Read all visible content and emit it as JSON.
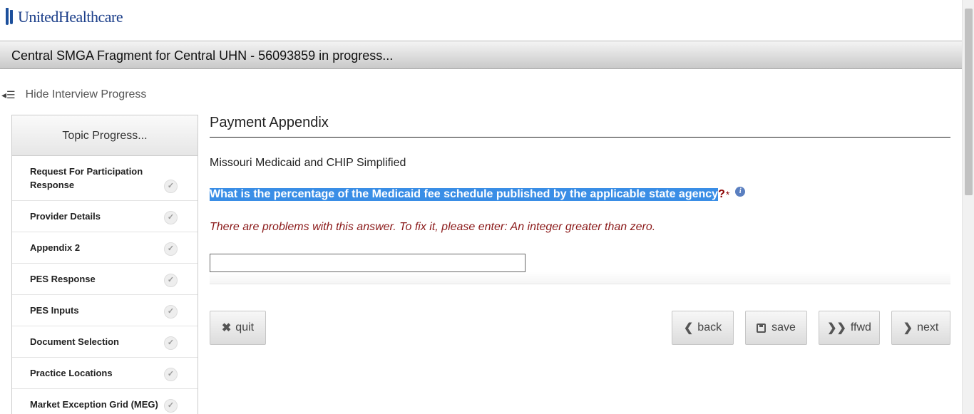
{
  "brand": {
    "name": "UnitedHealthcare"
  },
  "titlebar": {
    "text": "Central SMGA Fragment for Central UHN - 56093859 in progress..."
  },
  "progress_toggle": {
    "icon": "menu-icon",
    "label": "Hide Interview Progress"
  },
  "sidebar": {
    "title": "Topic Progress...",
    "items": [
      {
        "label": "Request For Participation Response",
        "status": "complete"
      },
      {
        "label": "Provider Details",
        "status": "complete"
      },
      {
        "label": "Appendix 2",
        "status": "complete"
      },
      {
        "label": "PES Response",
        "status": "complete"
      },
      {
        "label": "PES Inputs",
        "status": "complete"
      },
      {
        "label": "Document Selection",
        "status": "complete"
      },
      {
        "label": "Practice Locations",
        "status": "complete"
      },
      {
        "label": "Market Exception Grid (MEG)",
        "status": "complete"
      }
    ]
  },
  "main": {
    "section_title": "Payment Appendix",
    "subtitle": "Missouri Medicaid and CHIP Simplified",
    "question": {
      "text": "What is the percentage of the Medicaid fee schedule published by the applicable state agency",
      "mark": "?",
      "required": "*",
      "info_icon": "info-icon"
    },
    "error": "There are problems with this answer. To fix it, please enter: An integer greater than zero.",
    "answer": {
      "value": "",
      "placeholder": ""
    }
  },
  "buttons": {
    "quit": {
      "label": "quit",
      "icon": "x-icon"
    },
    "back": {
      "label": "back",
      "icon": "chevron-left-icon"
    },
    "save": {
      "label": "save",
      "icon": "floppy-icon"
    },
    "ffwd": {
      "label": "ffwd",
      "icon": "double-chevron-right-icon"
    },
    "next": {
      "label": "next",
      "icon": "chevron-right-icon"
    }
  },
  "colors": {
    "brand": "#1c3f8a",
    "highlight": "#3a8ee6",
    "error": "#8b1a1a"
  }
}
